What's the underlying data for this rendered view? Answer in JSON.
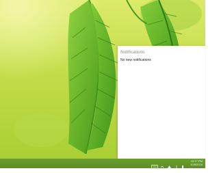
{
  "action_center": {
    "title": "Notifications",
    "empty_message": "No new notifications"
  },
  "taskbar": {
    "clock": {
      "time": "12:17 PM",
      "date": "10/8/2016"
    },
    "tray_icons": [
      "keyboard-icon",
      "chevron-up-icon",
      "network-icon",
      "volume-icon",
      "notification-icon"
    ]
  },
  "colors": {
    "taskbar": "#5d8f26",
    "panel_bg": "#ffffff",
    "panel_title": "#8a8a8a",
    "leaf": "#4fa31c"
  }
}
